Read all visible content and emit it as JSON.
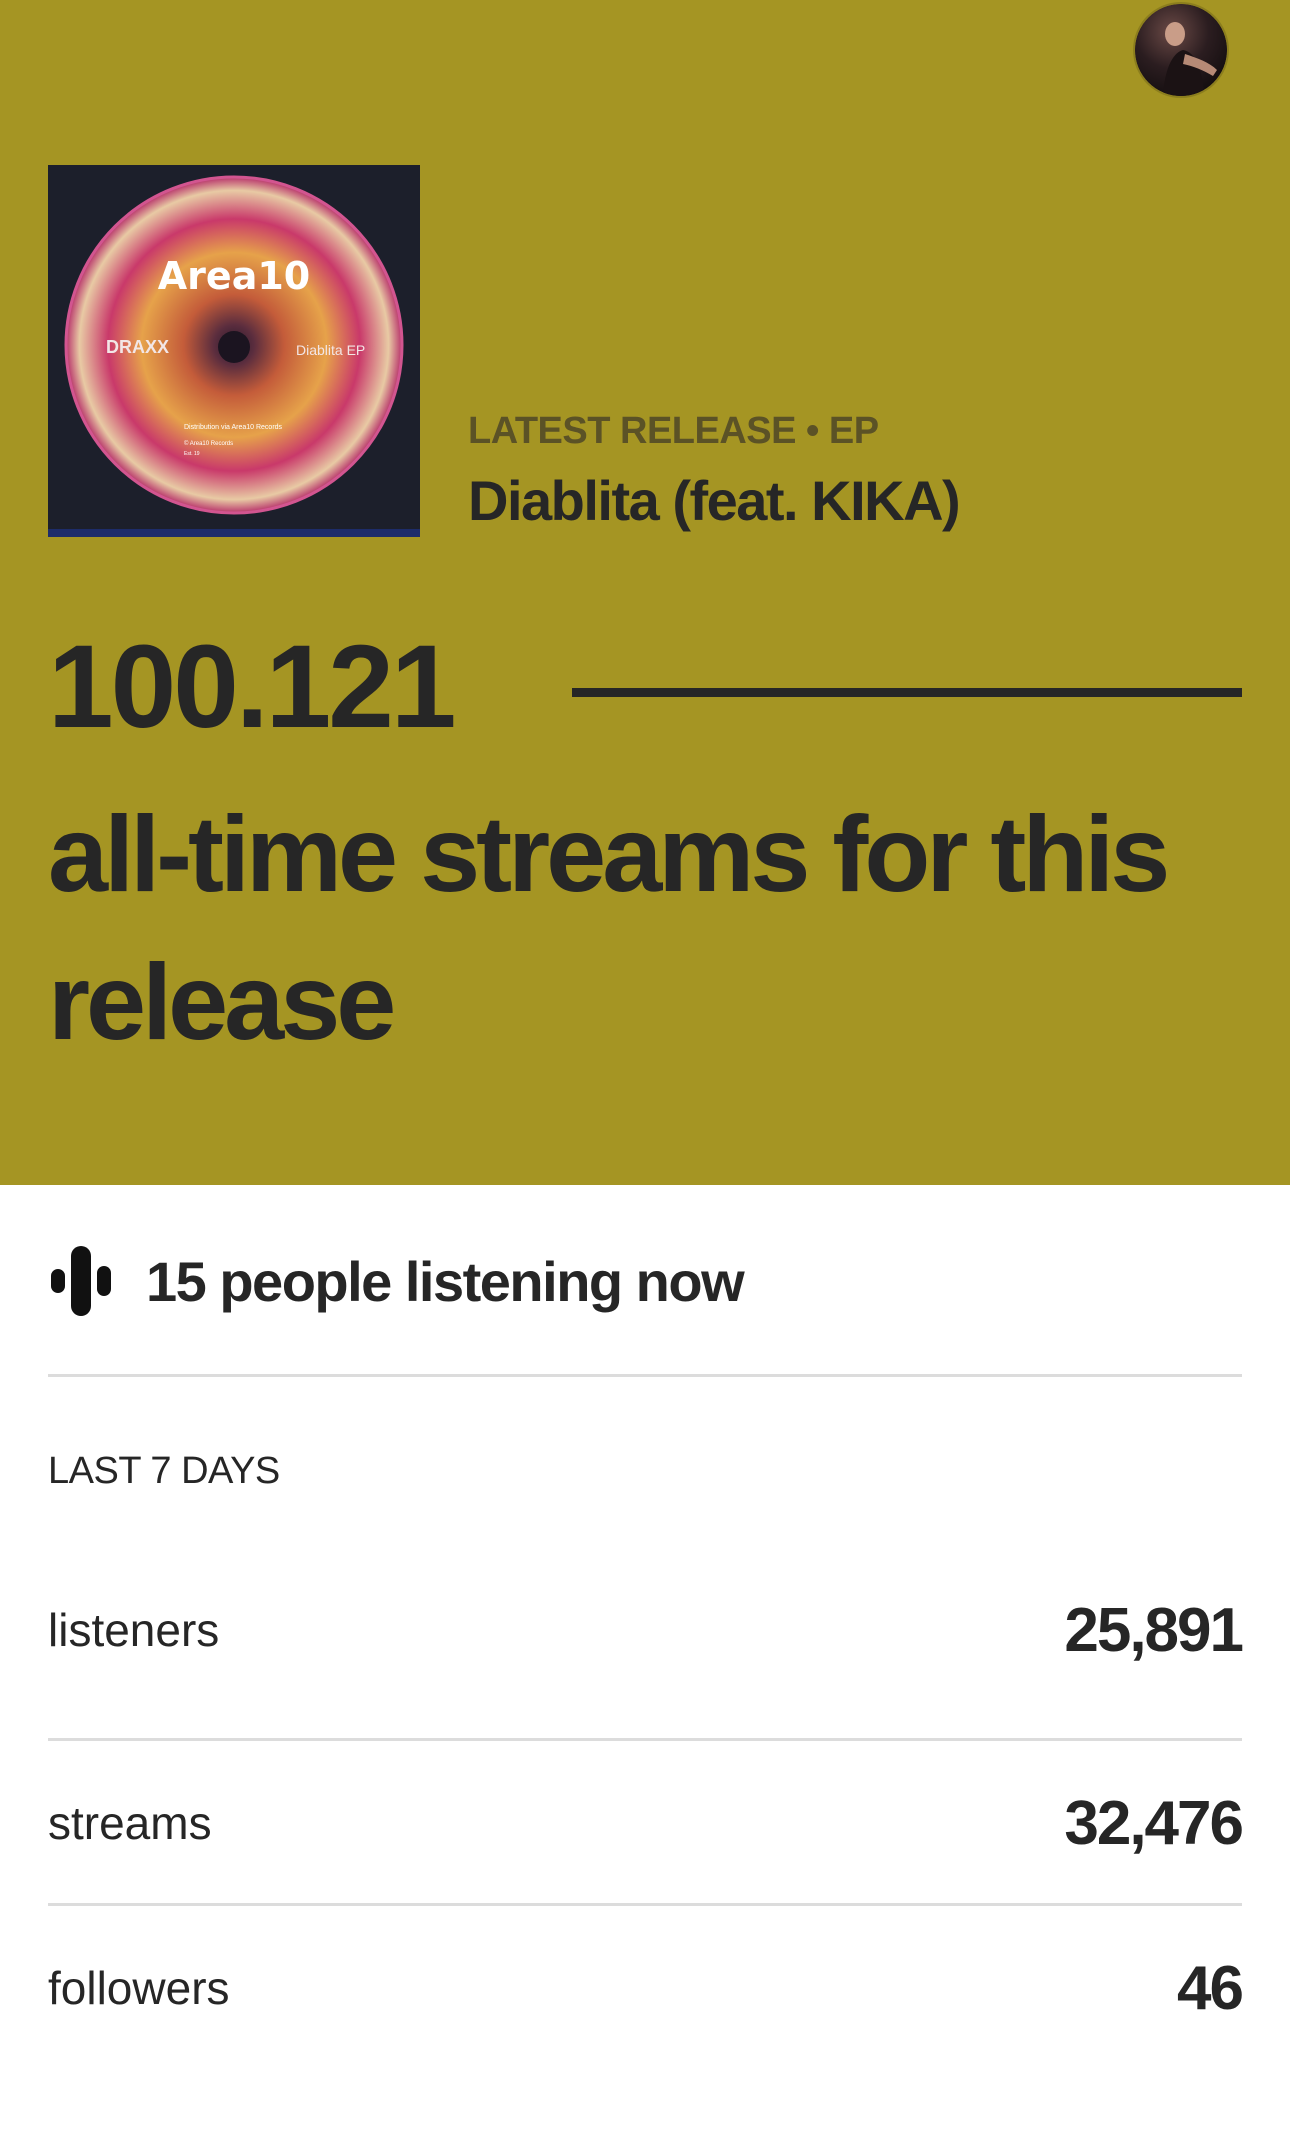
{
  "hero": {
    "background_color": "#a59523",
    "avatar": {
      "icon": "profile-avatar-photo"
    },
    "cover": {
      "label": "Area10",
      "artist": "DRAXX",
      "ep_name": "Diablita EP",
      "small_print": [
        "Distribution via Area10 Records",
        "© Area10 Records",
        "Est. 19"
      ]
    },
    "eyebrow": "LATEST RELEASE • EP",
    "title": "Diablita (feat. KIKA)",
    "all_time_streams": "100.121",
    "caption": "all-time streams for this release"
  },
  "live": {
    "icon": "audio-bars-icon",
    "text": "15 people listening now"
  },
  "period": {
    "label": "LAST 7 DAYS"
  },
  "stats": [
    {
      "name": "listeners",
      "value": "25,891"
    },
    {
      "name": "streams",
      "value": "32,476"
    },
    {
      "name": "followers",
      "value": "46"
    }
  ]
}
